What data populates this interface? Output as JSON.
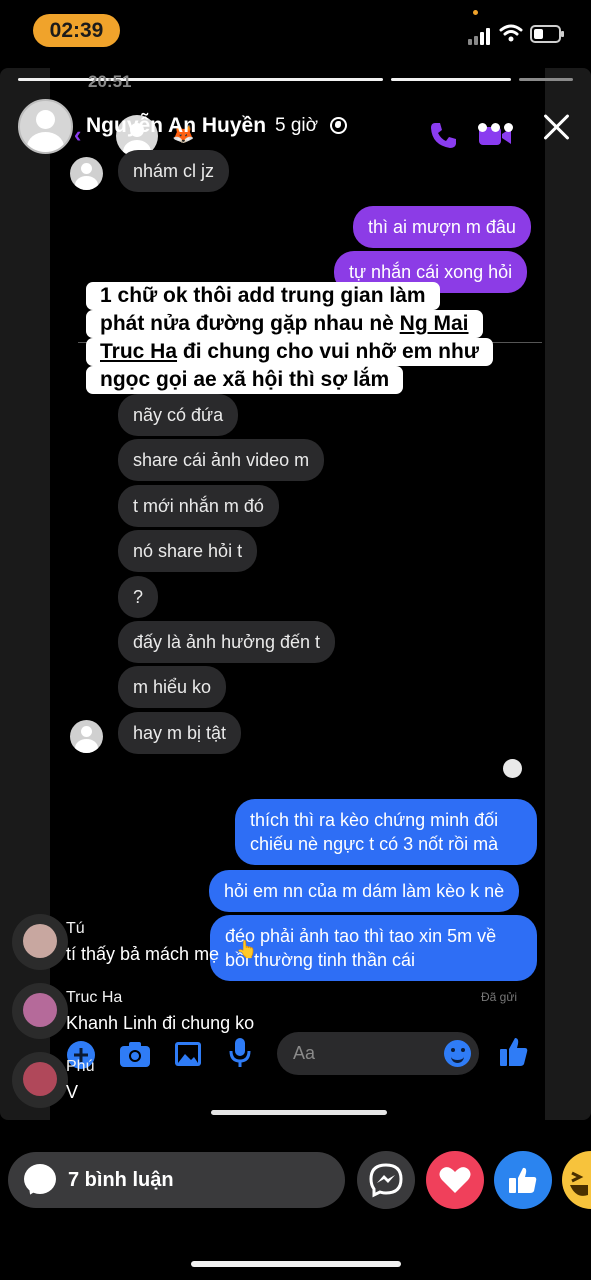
{
  "device": {
    "time": "02:39"
  },
  "story": {
    "owner_name": "Nguyễn An Huyền",
    "posted_ago": "5 giờ",
    "screenshot_time": "20:51"
  },
  "caption": {
    "line1": "1 chữ ok thôi add trung gian làm",
    "line2_a": "phát nửa đường gặp nhau nè ",
    "line2_mention": "Ng Mai",
    "line3_mention": "Truc Ha",
    "line3_b": " đi chung cho vui nhỡ em như",
    "line4": "ngọc gọi ae xã hội thì sợ lắm"
  },
  "messages": {
    "received_top": "nhám cl jz",
    "sent_1": "thì ai mượn m đâu",
    "sent_2": "tự nhắn cái xong hỏi",
    "received": [
      "nãy có đứa",
      "share cái ảnh video m",
      "t mới nhắn m đó",
      "nó share hỏi t",
      "?",
      "đấy là ảnh hưởng đến t",
      "m hiểu ko",
      "hay m bị tật"
    ],
    "sent_blue_1": "thích thì ra kèo chứng minh đối chiếu nè ngực t có 3 nốt rồi mà",
    "sent_blue_2": "hỏi em nn của m dám làm kèo k nè",
    "sent_blue_3": "đéo phải ảnh tao thì tao xin 5m về bồi thường tinh thần cái",
    "status": "Đã gửi"
  },
  "composer": {
    "placeholder": "Aa"
  },
  "comments": [
    {
      "name": "Tú",
      "text": "tí thấy bả mách mẹ"
    },
    {
      "name": "Truc Ha",
      "text": "Khanh Linh đi chung ko"
    },
    {
      "name": "Phú",
      "text": "V"
    }
  ],
  "bottom_bar": {
    "comment_count_label": "7 bình luận"
  },
  "colors": {
    "time_pill": "#f0a32b",
    "sent_purple": "#8c3ce6",
    "sent_blue": "#2e6ef5",
    "messenger_purple": "#8a3cf0",
    "love": "#f0405b",
    "like": "#2b84ef"
  },
  "icons": [
    "signal-icon",
    "wifi-icon",
    "battery-icon",
    "globe-icon",
    "more-icon",
    "close-icon",
    "call-icon",
    "video-call-icon",
    "plus-icon",
    "camera-icon",
    "gallery-icon",
    "mic-icon",
    "smiley-icon",
    "like-thumb-icon",
    "comment-bubble-icon",
    "messenger-icon",
    "heart-icon",
    "haha-icon"
  ]
}
